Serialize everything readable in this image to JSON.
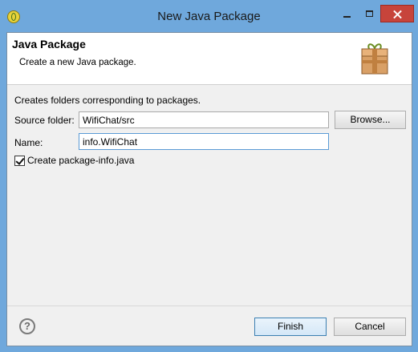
{
  "window": {
    "title": "New Java Package"
  },
  "banner": {
    "title": "Java Package",
    "description": "Create a new Java package.",
    "icon": "package-icon"
  },
  "form": {
    "description": "Creates folders corresponding to packages.",
    "source_folder_label": "Source folder:",
    "source_folder_value": "WifiChat/src",
    "browse_label": "Browse...",
    "name_label": "Name:",
    "name_value": "info.WifiChat",
    "create_package_info_label": "Create package-info.java",
    "create_package_info_checked": true
  },
  "footer": {
    "help_icon": "?",
    "finish_label": "Finish",
    "cancel_label": "Cancel"
  },
  "colors": {
    "titlebar": "#6fa8dc",
    "close_button": "#c7443b",
    "dialog_background": "#f0f0f0"
  }
}
